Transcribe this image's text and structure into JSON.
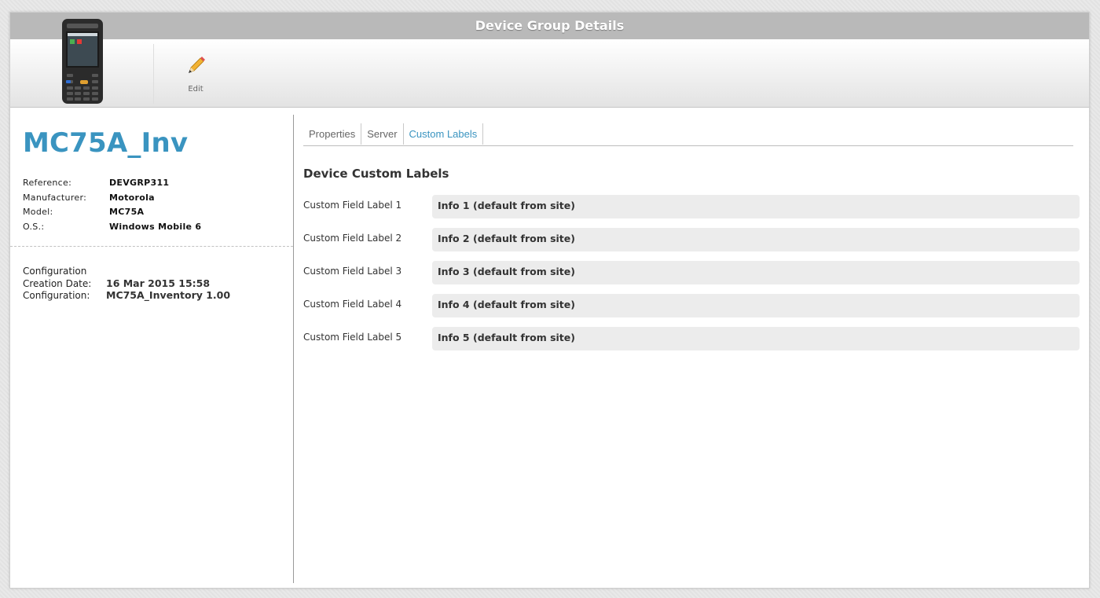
{
  "window": {
    "title": "Device Group Details"
  },
  "toolbar": {
    "edit_label": "Edit"
  },
  "group": {
    "name": "MC75A_Inv",
    "properties": [
      {
        "label": "Reference:",
        "value": "DEVGRP311"
      },
      {
        "label": "Manufacturer:",
        "value": "Motorola"
      },
      {
        "label": "Model:",
        "value": "MC75A"
      },
      {
        "label": "O.S.:",
        "value": "Windows Mobile 6"
      }
    ],
    "configuration": {
      "heading": "Configuration",
      "creation_date_label": "Creation Date:",
      "creation_date": "16 Mar 2015 15:58",
      "config_label": "Configuration:",
      "config_value": "MC75A_Inventory 1.00"
    }
  },
  "tabs": [
    {
      "label": "Properties",
      "active": false
    },
    {
      "label": "Server",
      "active": false
    },
    {
      "label": "Custom Labels",
      "active": true
    }
  ],
  "custom_labels": {
    "title": "Device Custom Labels",
    "fields": [
      {
        "label": "Custom Field Label 1",
        "value": "Info 1 (default from site)"
      },
      {
        "label": "Custom Field Label 2",
        "value": "Info 2 (default from site)"
      },
      {
        "label": "Custom Field Label 3",
        "value": "Info 3 (default from site)"
      },
      {
        "label": "Custom Field Label 4",
        "value": "Info 4 (default from site)"
      },
      {
        "label": "Custom Field Label 5",
        "value": "Info 5 (default from site)"
      }
    ]
  },
  "colors": {
    "accent": "#3a94c0",
    "titlebar": "#b9b9b9"
  },
  "icons": {
    "device": "mobile-computer-icon",
    "edit": "pencil-icon"
  }
}
